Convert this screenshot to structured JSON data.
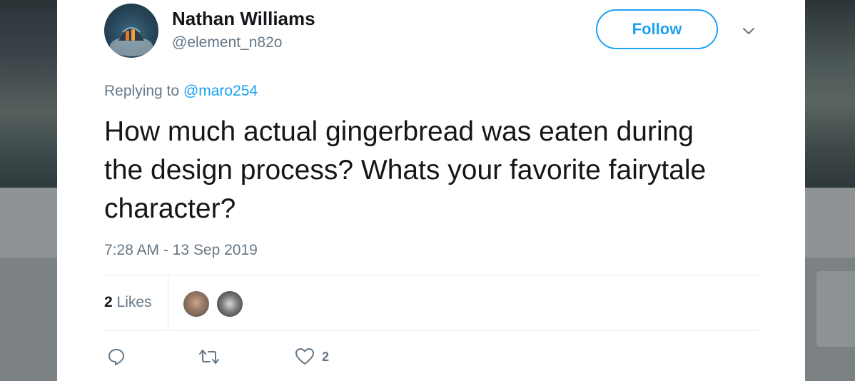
{
  "tweet": {
    "author_name": "Nathan Williams",
    "author_handle": "@element_n82o",
    "follow_label": "Follow",
    "replying_prefix": "Replying to",
    "replying_to": "@maro254",
    "text": "How much actual gingerbread was eaten during the design process? Whats your favorite fairytale character?",
    "timestamp": "7:28 AM - 13 Sep 2019",
    "likes_count": "2",
    "likes_label": "Likes",
    "like_action_count": "2"
  },
  "colors": {
    "accent": "#1da1f2",
    "text_primary": "#14171a",
    "text_secondary": "#657786"
  },
  "icons": {
    "reply": "reply-icon",
    "retweet": "retweet-icon",
    "like": "heart-icon",
    "caret": "chevron-down-icon"
  }
}
